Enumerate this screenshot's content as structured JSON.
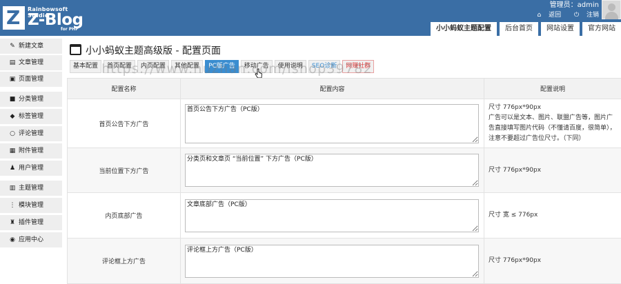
{
  "header": {
    "logo_letter": "Z",
    "logo_studio": "Rainbowsoft Studio",
    "logo_main": "Z-Blog",
    "logo_php": "for PHP",
    "admin_label": "管理员：admin",
    "back_label": "返回",
    "logout_label": "注销",
    "tabs": [
      {
        "label": "小小蚂蚁主题配置",
        "active": true
      },
      {
        "label": "后台首页"
      },
      {
        "label": "网站设置"
      },
      {
        "label": "官方网站"
      }
    ]
  },
  "sidebar": {
    "items": [
      {
        "label": "新建文章",
        "icon": "edit-icon"
      },
      {
        "label": "文章管理",
        "icon": "document-icon"
      },
      {
        "label": "页面管理",
        "icon": "page-icon"
      },
      {
        "label": "分类管理",
        "icon": "folder-icon"
      },
      {
        "label": "标签管理",
        "icon": "tag-icon"
      },
      {
        "label": "评论管理",
        "icon": "comment-icon"
      },
      {
        "label": "附件管理",
        "icon": "attachment-icon"
      },
      {
        "label": "用户管理",
        "icon": "user-icon"
      },
      {
        "label": "主题管理",
        "icon": "theme-icon"
      },
      {
        "label": "模块管理",
        "icon": "module-icon"
      },
      {
        "label": "插件管理",
        "icon": "plugin-icon"
      },
      {
        "label": "应用中心",
        "icon": "app-center-icon"
      }
    ]
  },
  "main": {
    "page_title": "小小蚂蚁主题高级版 - 配置页面",
    "tabs": [
      {
        "label": "基本配置"
      },
      {
        "label": "首页配置"
      },
      {
        "label": "内页配置"
      },
      {
        "label": "其他配置"
      },
      {
        "label": "PC版广告",
        "active": true
      },
      {
        "label": "移动广告"
      },
      {
        "label": "使用说明"
      },
      {
        "label": "SEO诊断",
        "style": "blue"
      },
      {
        "label": "网赚社群",
        "style": "red"
      }
    ],
    "watermark": "https://www.huzhan.com/ishop39782",
    "table": {
      "headers": [
        "配置名称",
        "配置内容",
        "配置说明"
      ],
      "rows": [
        {
          "name": "首页公告下方广告",
          "content": "首页公告下方广告（PC版）",
          "desc": "尺寸 776px*90px\n广告可以是文本、图片、联盟广告等，图片广告直接填写图片代码（不懂请百度，很简单），注意不要超过广告位尺寸。（下同）"
        },
        {
          "name": "当前位置下方广告",
          "content": "分类页和文章页 “当前位置” 下方广告（PC版）",
          "desc": "尺寸 776px*90px"
        },
        {
          "name": "内页底部广告",
          "content": "文章底部广告（PC版）",
          "desc": "尺寸 宽 ≤ 776px"
        },
        {
          "name": "评论框上方广告",
          "content": "评论框上方广告（PC版）",
          "desc": "尺寸 776px*90px"
        }
      ]
    }
  },
  "colors": {
    "header_bg": "#3a6ea5",
    "active_tab": "#3a8dd0",
    "red_tab": "#e04040"
  }
}
